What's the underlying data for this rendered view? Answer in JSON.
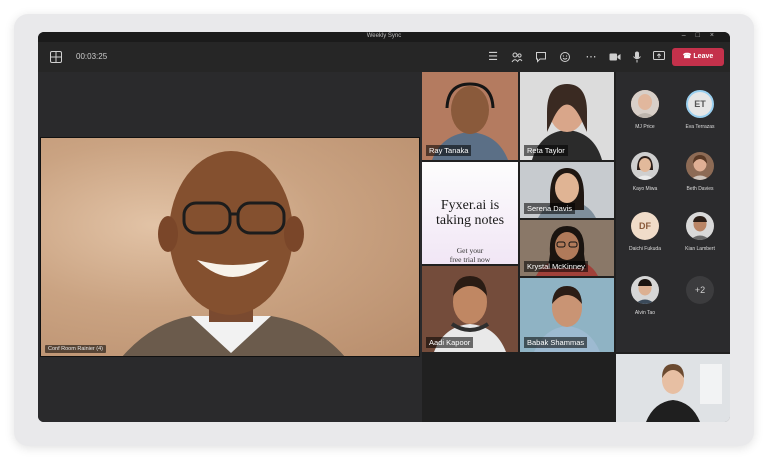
{
  "window": {
    "title": "Weekly Sync"
  },
  "toolbar": {
    "timer": "00:03:25",
    "leave_label": "Leave"
  },
  "main": {
    "room_label": "Conf Room Rainier (4)"
  },
  "tiles": [
    {
      "name": "Ray Tanaka"
    },
    {
      "name": "Reta Taylor"
    },
    {
      "name": "Serena Davis"
    },
    {
      "name": "Krystal McKinney"
    },
    {
      "name": "Aadi Kapoor"
    },
    {
      "name": "Babak Shammas"
    }
  ],
  "promo": {
    "title_line1": "Fyxer.ai is",
    "title_line2": "taking notes",
    "sub_line1": "Get your",
    "sub_line2": "free trial now"
  },
  "roster": [
    {
      "name": "MJ Price",
      "initials": ""
    },
    {
      "name": "Eva Terrazas",
      "initials": "ET"
    },
    {
      "name": "Kayo Miwa",
      "initials": ""
    },
    {
      "name": "Beth Davies",
      "initials": ""
    },
    {
      "name": "Daichi Fukuda",
      "initials": "DF"
    },
    {
      "name": "Kian Lambert",
      "initials": ""
    },
    {
      "name": "Alvin Tao",
      "initials": ""
    },
    {
      "name": "",
      "initials": "+2"
    }
  ],
  "colors": {
    "leave": "#c4314b",
    "background": "#202020",
    "accent_ring": "#9ad0f0"
  }
}
